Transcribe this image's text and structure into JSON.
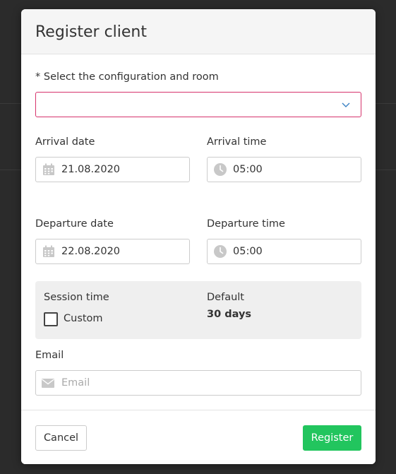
{
  "dialog": {
    "title": "Register client"
  },
  "form": {
    "configuration_label": "* Select the configuration and room",
    "configuration_value": "",
    "arrival_date_label": "Arrival date",
    "arrival_date_value": "21.08.2020",
    "arrival_time_label": "Arrival time",
    "arrival_time_value": "05:00",
    "departure_date_label": "Departure date",
    "departure_date_value": "22.08.2020",
    "departure_time_label": "Departure time",
    "departure_time_value": "05:00",
    "session_time_label": "Session time",
    "custom_label": "Custom",
    "custom_checked": false,
    "default_label": "Default",
    "default_value": "30 days",
    "email_label": "Email",
    "email_placeholder": "Email",
    "email_value": ""
  },
  "footer": {
    "cancel_label": "Cancel",
    "register_label": "Register"
  },
  "colors": {
    "required_border": "#d6336c",
    "chevron": "#3b82c4",
    "primary_button": "#22c55e",
    "icon_gray": "#c8c8c8"
  },
  "icons": {
    "select": "chevron-down-icon",
    "date": "calendar-icon",
    "time": "clock-icon",
    "email": "envelope-icon"
  }
}
